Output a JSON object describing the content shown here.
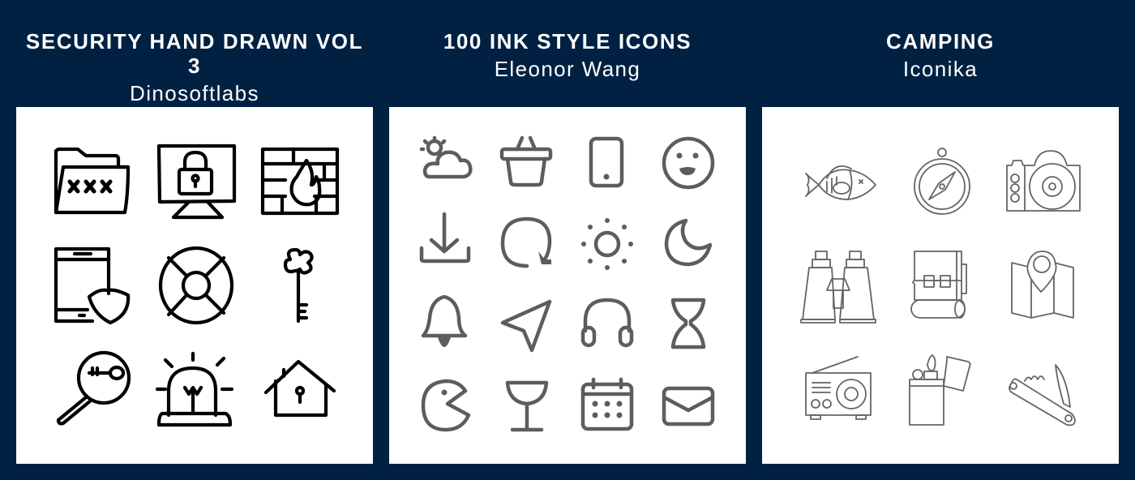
{
  "colors": {
    "background": "#002142",
    "panel": "#ffffff",
    "header_text": "#ffffff",
    "ink_black": "#000000",
    "ink_gray": "#5d5d5d",
    "sketch_gray": "#4a4a4a"
  },
  "packs": [
    {
      "title": "SECURITY HAND DRAWN VOL 3",
      "author": "Dinosoftlabs",
      "icons": [
        "folder-xxx-icon",
        "monitor-lock-icon",
        "firewall-icon",
        "tablet-shield-icon",
        "lifebuoy-icon",
        "key-icon",
        "search-key-icon",
        "siren-icon",
        "house-lock-icon"
      ]
    },
    {
      "title": "100 INK STYLE ICONS",
      "author": "Eleonor Wang",
      "icons": [
        "partly-cloudy-icon",
        "basket-icon",
        "phone-icon",
        "smiley-icon",
        "download-icon",
        "refresh-icon",
        "sun-icon",
        "moon-icon",
        "bell-icon",
        "send-icon",
        "headphones-icon",
        "hourglass-icon",
        "pacman-icon",
        "cocktail-glass-icon",
        "calendar-icon",
        "mail-icon"
      ]
    },
    {
      "title": "CAMPING",
      "author": "Iconika",
      "icons": [
        "fish-icon",
        "compass-icon",
        "camera-icon",
        "binoculars-icon",
        "backpack-icon",
        "map-pin-icon",
        "radio-icon",
        "lighter-icon",
        "pocket-knife-icon"
      ]
    }
  ]
}
